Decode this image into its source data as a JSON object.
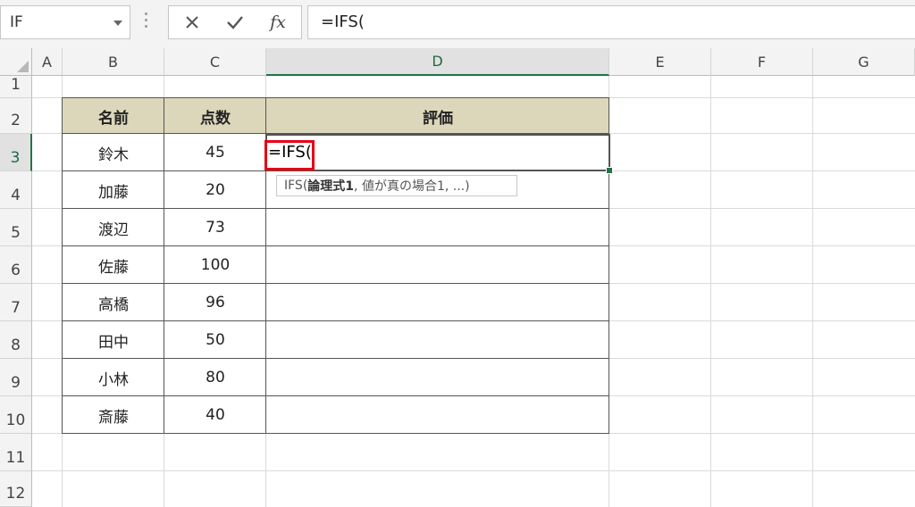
{
  "name_box": {
    "value": "IF"
  },
  "formula_bar": {
    "cancel_glyph": "✕",
    "enter_glyph": "✔",
    "fx_label": "fx",
    "value": "=IFS("
  },
  "columns": [
    "A",
    "B",
    "C",
    "D",
    "E",
    "F",
    "G"
  ],
  "selected_column": "D",
  "rows": [
    "1",
    "2",
    "3",
    "4",
    "5",
    "6",
    "7",
    "8",
    "9",
    "10",
    "11",
    "12"
  ],
  "selected_row": "3",
  "table": {
    "headers": [
      "名前",
      "点数",
      "評価"
    ],
    "records": [
      {
        "name": "鈴木",
        "score": "45"
      },
      {
        "name": "加藤",
        "score": "20"
      },
      {
        "name": "渡辺",
        "score": "73"
      },
      {
        "name": "佐藤",
        "score": "100"
      },
      {
        "name": "高橋",
        "score": "96"
      },
      {
        "name": "田中",
        "score": "50"
      },
      {
        "name": "小林",
        "score": "80"
      },
      {
        "name": "斎藤",
        "score": "40"
      }
    ]
  },
  "editing_cell": {
    "text": "=IFS("
  },
  "tooltip": {
    "prefix": "IFS(",
    "bold_arg": "論理式1",
    "rest": ", 値が真の場合1, ...)"
  },
  "colors": {
    "header_fill": "#dcd7bb",
    "highlight_box": "#e60012",
    "excel_green": "#217346"
  }
}
